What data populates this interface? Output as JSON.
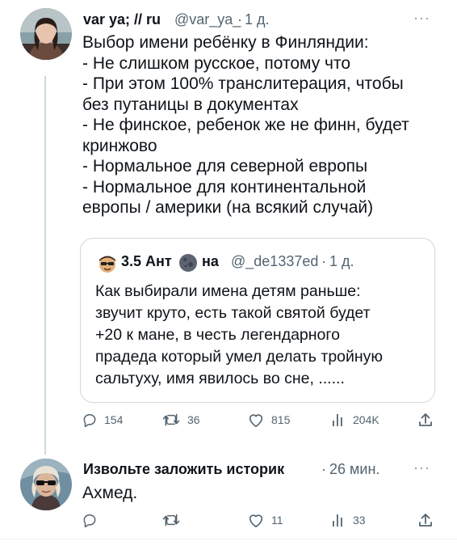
{
  "tweet1": {
    "name": "var ya; // ru",
    "handle": "@var_ya_",
    "sep": "·",
    "time": "1 д.",
    "more": "···",
    "text": "Выбор имени ребёнку в Финляндии:\n- Не слишком русское, потому что\n- При этом 100% транслитерация, чтобы\nбез путаницы в документах\n- Не финское, ребенок же не финн, будет\nкринжово\n- Нормальное для северной европы\n- Нормальное для континентальной\nевропы / америки (на всякий случай)"
  },
  "quote": {
    "name_part1": "3.5 Ант",
    "name_part2": "на",
    "handle": "@_de1337ed",
    "sep": "·",
    "time": "1 д.",
    "text": "Как выбирали имена детям раньше:\nзвучит круто, есть такой святой будет\n+20 к мане, в честь легендарного\nпрадеда который умел делать тройную\nсальтуху, имя явилось во сне, ......"
  },
  "tweet1_actions": {
    "replies": "154",
    "retweets": "36",
    "likes": "815",
    "views": "204K"
  },
  "tweet2": {
    "name": "Извольте заложить историк",
    "sep": "·",
    "time": "26 мин.",
    "more": "···",
    "text": "Ахмед."
  },
  "tweet2_actions": {
    "replies": "",
    "retweets": "",
    "likes": "11",
    "views": "33"
  },
  "colors": {
    "text": "#0f1419",
    "secondary": "#536471",
    "border": "#cfd9de"
  }
}
